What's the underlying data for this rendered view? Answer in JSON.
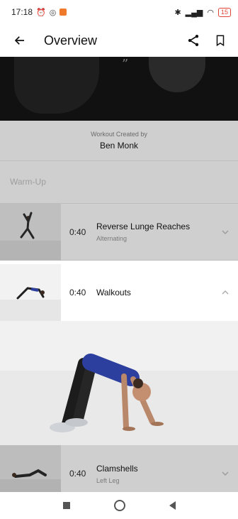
{
  "status_bar": {
    "time": "17:18",
    "battery": "15"
  },
  "header": {
    "title": "Overview"
  },
  "hero": {
    "quote_mark": "”"
  },
  "creator": {
    "label": "Workout Created by",
    "name": "Ben Monk"
  },
  "section": {
    "title": "Warm-Up"
  },
  "exercises": [
    {
      "time": "0:40",
      "name": "Reverse Lunge Reaches",
      "sub": "Alternating",
      "expanded": false
    },
    {
      "time": "0:40",
      "name": "Walkouts",
      "sub": "",
      "expanded": true
    },
    {
      "time": "0:40",
      "name": "Clamshells",
      "sub": "Left Leg",
      "expanded": false
    }
  ],
  "colors": {
    "accent_top": "#f07a2c",
    "battery_low": "#e0453a",
    "shirt": "#2c3f9e",
    "dim_overlay": "#cfcfcf"
  },
  "icons": [
    "back-arrow-icon",
    "share-icon",
    "bookmark-icon",
    "chevron-down-icon",
    "chevron-up-icon"
  ]
}
